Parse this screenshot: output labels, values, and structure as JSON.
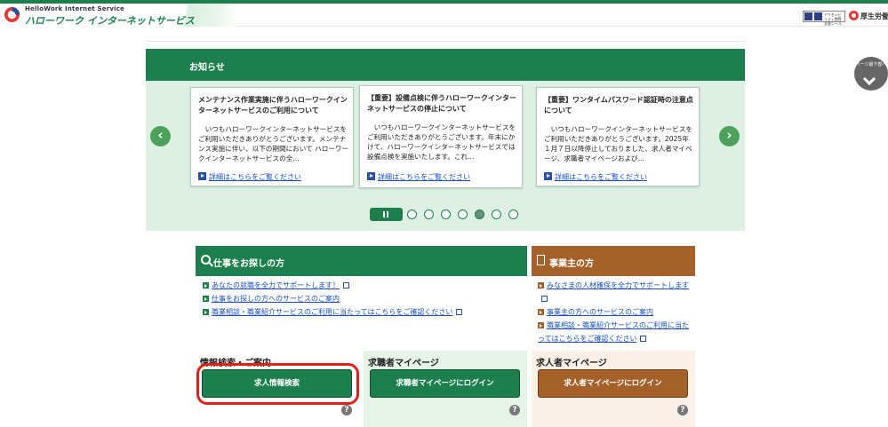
{
  "header": {
    "logo_en": "HelloWork Internet Service",
    "logo_jp": "ハローワーク インターネットサービス",
    "access_tool_text": "アクセシビリティ閲覧支援ツール",
    "ministry": "厚生労働省"
  },
  "page_nav": {
    "label": "ページ最下部へ"
  },
  "notice": {
    "title": "お知らせ",
    "cards": [
      {
        "title": "メンテナンス作業実施に伴うハローワークインターネットサービスのご利用について",
        "body": "　いつもハローワークインターネットサービスをご利用いただきありがとうございます。メンテナンス実施に伴い、以下の期間において ハローワークインターネットサービスの全...",
        "link": "詳細はこちらをご覧ください"
      },
      {
        "title": "【重要】設備点検に伴うハローワークインターネットサービスの停止について",
        "body": "　いつもハローワークインターネットサービスをご利用いただきありがとうございます。年末にかけて、ハローワークインターネットサービスでは設備点検を実施いたします。これ...",
        "link": "詳細はこちらをご覧ください"
      },
      {
        "title": "【重要】ワンタイムパスワード認証時の注意点について",
        "body": "　いつもハローワークインターネットサービスをご利用いただきありがとうございます。2025年１月７日以降停止しておりました、求人者マイページ、求職者マイページおよび...",
        "link": "詳細はこちらをご覧ください"
      }
    ],
    "prev_glyph": "‹",
    "next_glyph": "›",
    "page_count": 7,
    "active_page": 5
  },
  "job_seeker": {
    "title": "仕事をお探しの方",
    "links": [
      "あなたの就職を全力でサポートします！",
      "仕事をお探しの方へのサービスのご案内",
      "職業相談・職業紹介サービスのご利用に当たってはこちらをご確認ください"
    ]
  },
  "employer": {
    "title": "事業主の方",
    "links": [
      "みなさまの人材確保を全力でサポートします",
      "事業主の方へのサービスのご案内",
      "職業相談・職業紹介サービスのご利用に当たってはこちらをご確認ください"
    ]
  },
  "panels": {
    "search": {
      "title": "情報検索・ご案内",
      "button": "求人情報検索"
    },
    "seeker_mypage": {
      "title": "求職者マイページ",
      "button": "求職者マイページにログイン"
    },
    "employer_mypage": {
      "title": "求人者マイページ",
      "button": "求人者マイページにログイン"
    },
    "help_glyph": "?"
  },
  "colors": {
    "green": "#1e7f4e",
    "light_green": "#ddf0e3",
    "brown": "#a5612a",
    "highlight": "#e0201b"
  }
}
